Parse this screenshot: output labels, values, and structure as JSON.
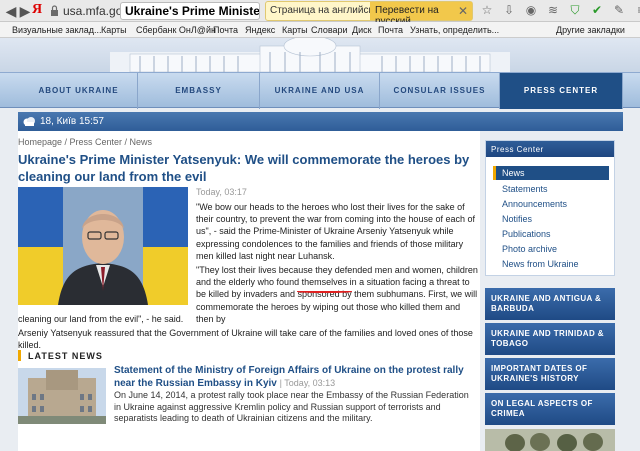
{
  "browser": {
    "logo": "Я",
    "url": "usa.mfa.gov.ua",
    "tab_title": "Ukraine's Prime Ministe...",
    "translate_en": "Страница на английском",
    "translate_ru": "Перевести на русский",
    "other_bookmarks": "Другие закладки"
  },
  "bookmarks": [
    "Визуальные заклад...",
    "Карты",
    "Сбербанк ОнЛ@йн",
    "Почта",
    "Яндекс",
    "Карты",
    "Словари",
    "Диск",
    "Почта",
    "Узнать, определить..."
  ],
  "menu": {
    "items": [
      "ABOUT UKRAINE",
      "EMBASSY",
      "UKRAINE AND USA",
      "CONSULAR ISSUES",
      "PRESS CENTER"
    ]
  },
  "weather": "18, Київ 15:57",
  "breadcrumb": "Homepage / Press Center / News",
  "article": {
    "title": "Ukraine's Prime Minister Yatsenyuk: We will commemorate the heroes by cleaning our land from the evil",
    "date": "Today, 03:17",
    "p1": "\"We bow our heads to the heroes who lost their lives for the sake of their country, to prevent the war from coming into the house of each of us\", - said the Prime-Minister of Ukraine Arseniy Yatsenyuk while expressing condolences to the families and friends of those military men killed last night near Luhansk.",
    "p2a": "\"They lost their lives because they defended men and women, children and the elderly who found themselves in a situation facing a threat to be killed by invaders and sponsored by them subhumans. First, we will commemorate the heroes by wiping out those who killed them and then by",
    "p2b": "cleaning our land from the evil\", - he said.",
    "p3": "Arseniy Yatsenyuk reassured that the Government of Ukraine will take care of the families and loved ones of those killed."
  },
  "latest": {
    "heading": "LATEST NEWS",
    "title": "Statement of the Ministry of Foreign Affairs of Ukraine on the protest rally near the Russian Embassy in Kyiv",
    "date": "| Today, 03:13",
    "text": "On June 14, 2014, a protest rally took place near the Embassy of the Russian Federation in Ukraine against aggressive Kremlin policy and Russian support of terrorists and separatists leading to death of Ukrainian citizens and the military."
  },
  "sidebar": {
    "heading": "Press Center",
    "links": [
      "News",
      "Statements",
      "Announcements",
      "Notifies",
      "Publications",
      "Photo archive",
      "News from Ukraine"
    ],
    "banners": [
      "UKRAINE AND ANTIGUA & BARBUDA",
      "UKRAINE AND TRINIDAD & TOBAGO",
      "IMPORTANT DATES OF UKRAINE'S HISTORY",
      "ON LEGAL ASPECTS OF CRIMEA"
    ]
  },
  "colors": {
    "accent": "#1f4f86",
    "highlight": "#f0a800",
    "underline": "#e02020"
  }
}
